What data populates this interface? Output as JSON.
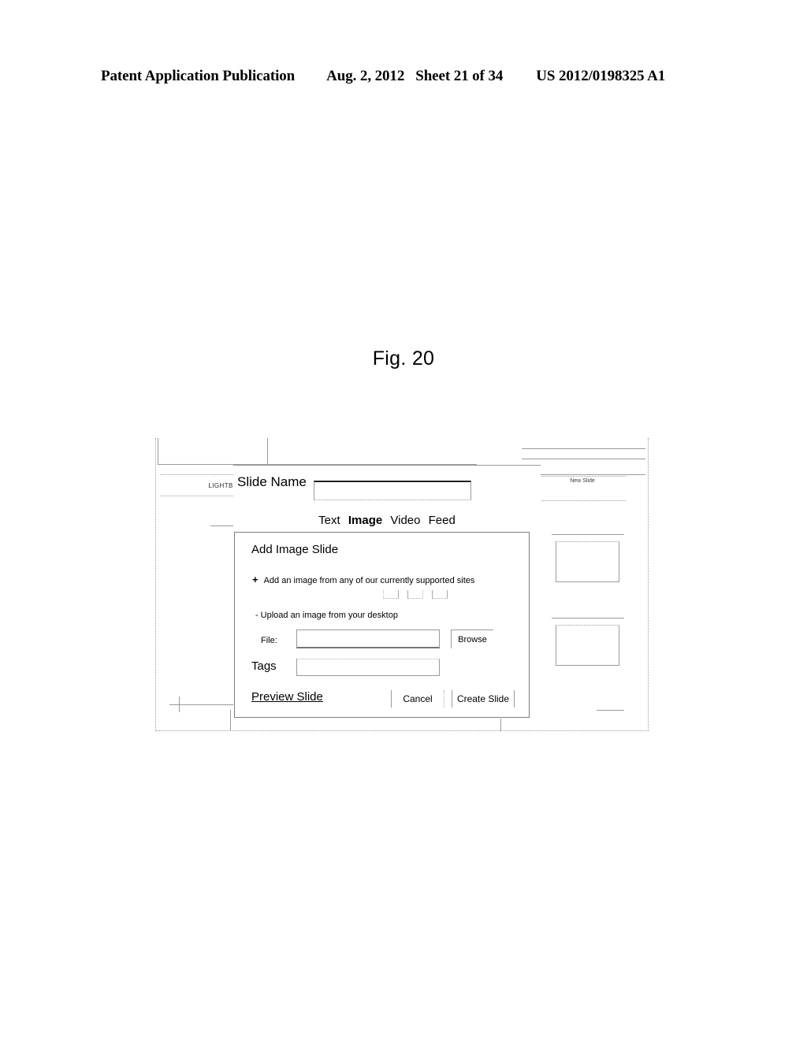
{
  "patent_header": {
    "publication": "Patent Application Publication",
    "date": "Aug. 2, 2012",
    "sheet": "Sheet 21 of 34",
    "number": "US 2012/0198325 A1"
  },
  "figure": {
    "caption": "Fig. 20"
  },
  "mockup": {
    "background": {
      "lightbox_tab_label": "LIGHTBOX A",
      "new_slide_label": "New Slide"
    },
    "modal": {
      "slide_name_label": "Slide Name",
      "slide_name_value": "",
      "slide_name_placeholder": "",
      "tabs": [
        {
          "label": "Text",
          "selected": false
        },
        {
          "label": "Image",
          "selected": true
        },
        {
          "label": "Video",
          "selected": false
        },
        {
          "label": "Feed",
          "selected": false
        }
      ],
      "panel": {
        "title": "Add Image Slide",
        "option_add_marker": "+",
        "option_add_text": "Add an image from any of our currently supported sites",
        "option_upload_marker": "-",
        "option_upload_text": "Upload an image from your desktop",
        "file_label": "File:",
        "file_value": "",
        "browse_label": "Browse",
        "tags_label": "Tags",
        "tags_value": "",
        "preview_link": "Preview Slide",
        "cancel_label": "Cancel",
        "create_label": "Create Slide"
      }
    }
  },
  "colors": {
    "ink": "#000000",
    "line": "#9a9a9a",
    "line_dark": "#6e6e6e",
    "panel_border": "#7d7d7d",
    "page": "#ffffff"
  }
}
